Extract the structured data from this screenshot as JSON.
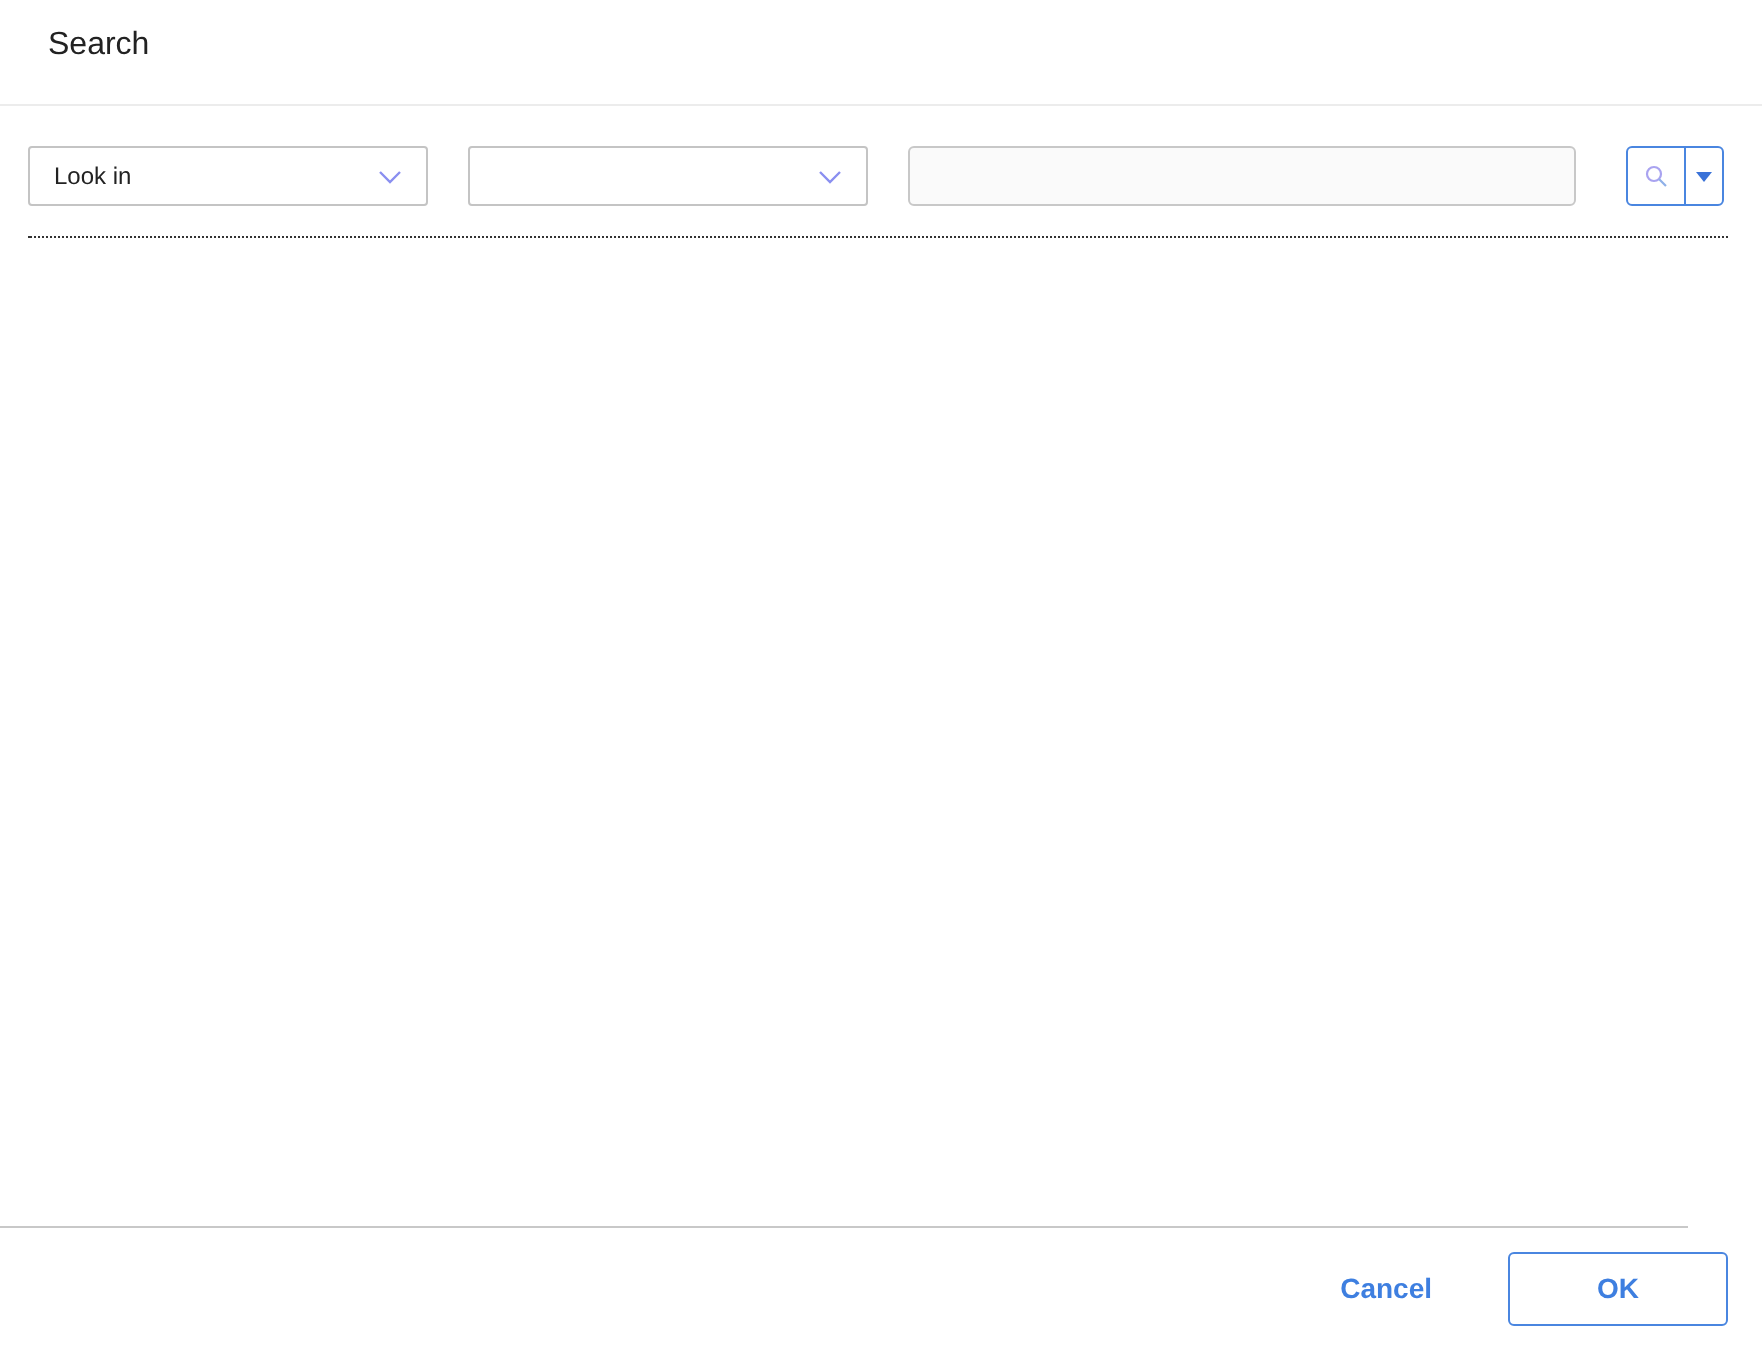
{
  "dialog": {
    "title": "Search"
  },
  "filters": {
    "look_in": {
      "value": "Look in"
    }
  },
  "buttons": [
    {
      "label": "Cancel",
      "kind": "link"
    },
    {
      "label": "OK",
      "kind": "outlined"
    }
  ]
}
